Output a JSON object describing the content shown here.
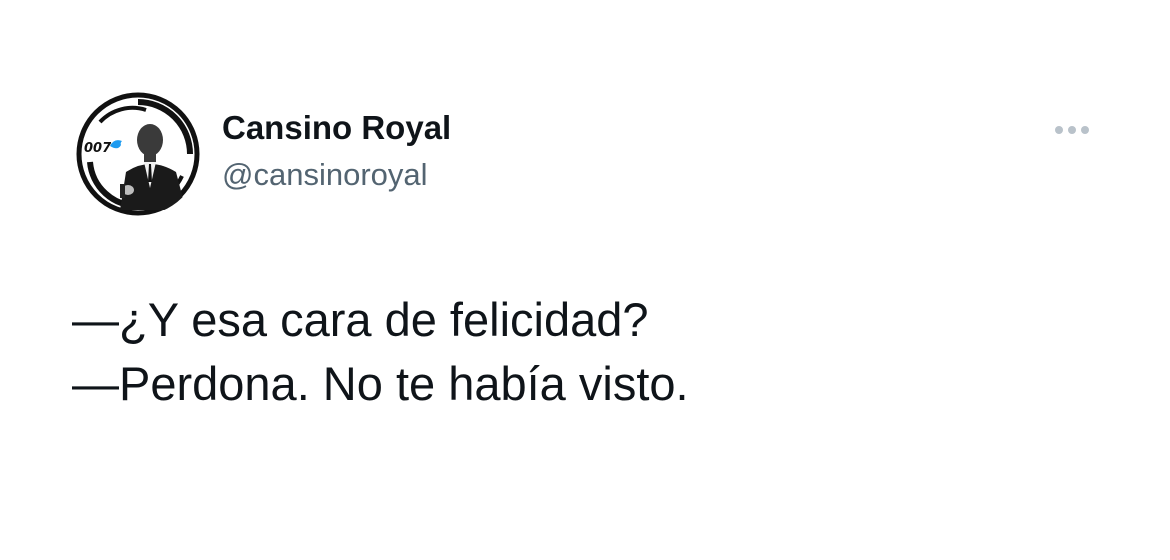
{
  "author": {
    "display_name": "Cansino Royal",
    "handle": "@cansinoroyal",
    "avatar_badge": "007"
  },
  "tweet": {
    "lines": [
      "—¿Y esa cara de felicidad?",
      "—Perdona. No te había visto."
    ]
  },
  "icons": {
    "more": "more-options-icon",
    "avatar_bird": "twitter-bird-icon"
  },
  "colors": {
    "text_primary": "#0f1419",
    "text_secondary": "#536471",
    "more_dots": "#b9c2ca",
    "bird_blue": "#1d9bf0"
  }
}
